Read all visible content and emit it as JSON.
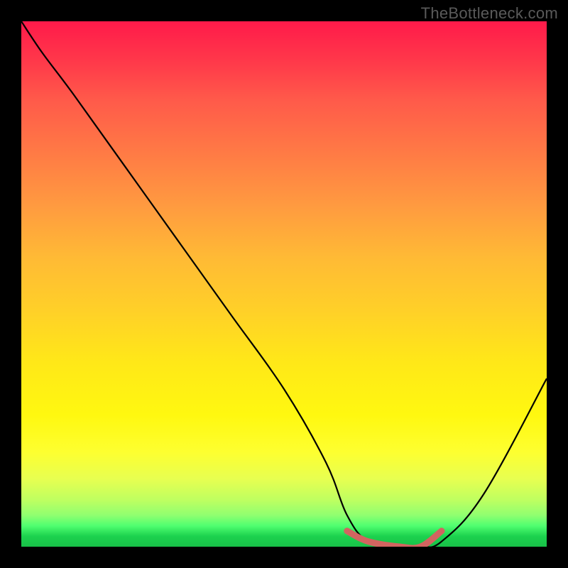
{
  "watermark": "TheBottleneck.com",
  "chart_data": {
    "type": "line",
    "title": "",
    "xlabel": "",
    "ylabel": "",
    "xlim": [
      0,
      100
    ],
    "ylim": [
      0,
      100
    ],
    "series": [
      {
        "name": "bottleneck-curve",
        "x": [
          0,
          4,
          10,
          20,
          30,
          40,
          50,
          58,
          62,
          66,
          72,
          76,
          80,
          88,
          100
        ],
        "y": [
          100,
          94,
          86,
          72,
          58,
          44,
          30,
          16,
          6,
          1,
          0,
          0,
          1,
          10,
          32
        ]
      }
    ],
    "highlight_segment": {
      "name": "optimal-range",
      "x": [
        62,
        66,
        72,
        76,
        80
      ],
      "y": [
        3,
        1,
        0,
        0,
        3
      ],
      "color": "#d26460"
    },
    "background": {
      "type": "vertical-gradient",
      "stops": [
        {
          "pos": 0,
          "color": "#ff1a4a"
        },
        {
          "pos": 50,
          "color": "#ffd028"
        },
        {
          "pos": 100,
          "color": "#18c048"
        }
      ]
    }
  }
}
